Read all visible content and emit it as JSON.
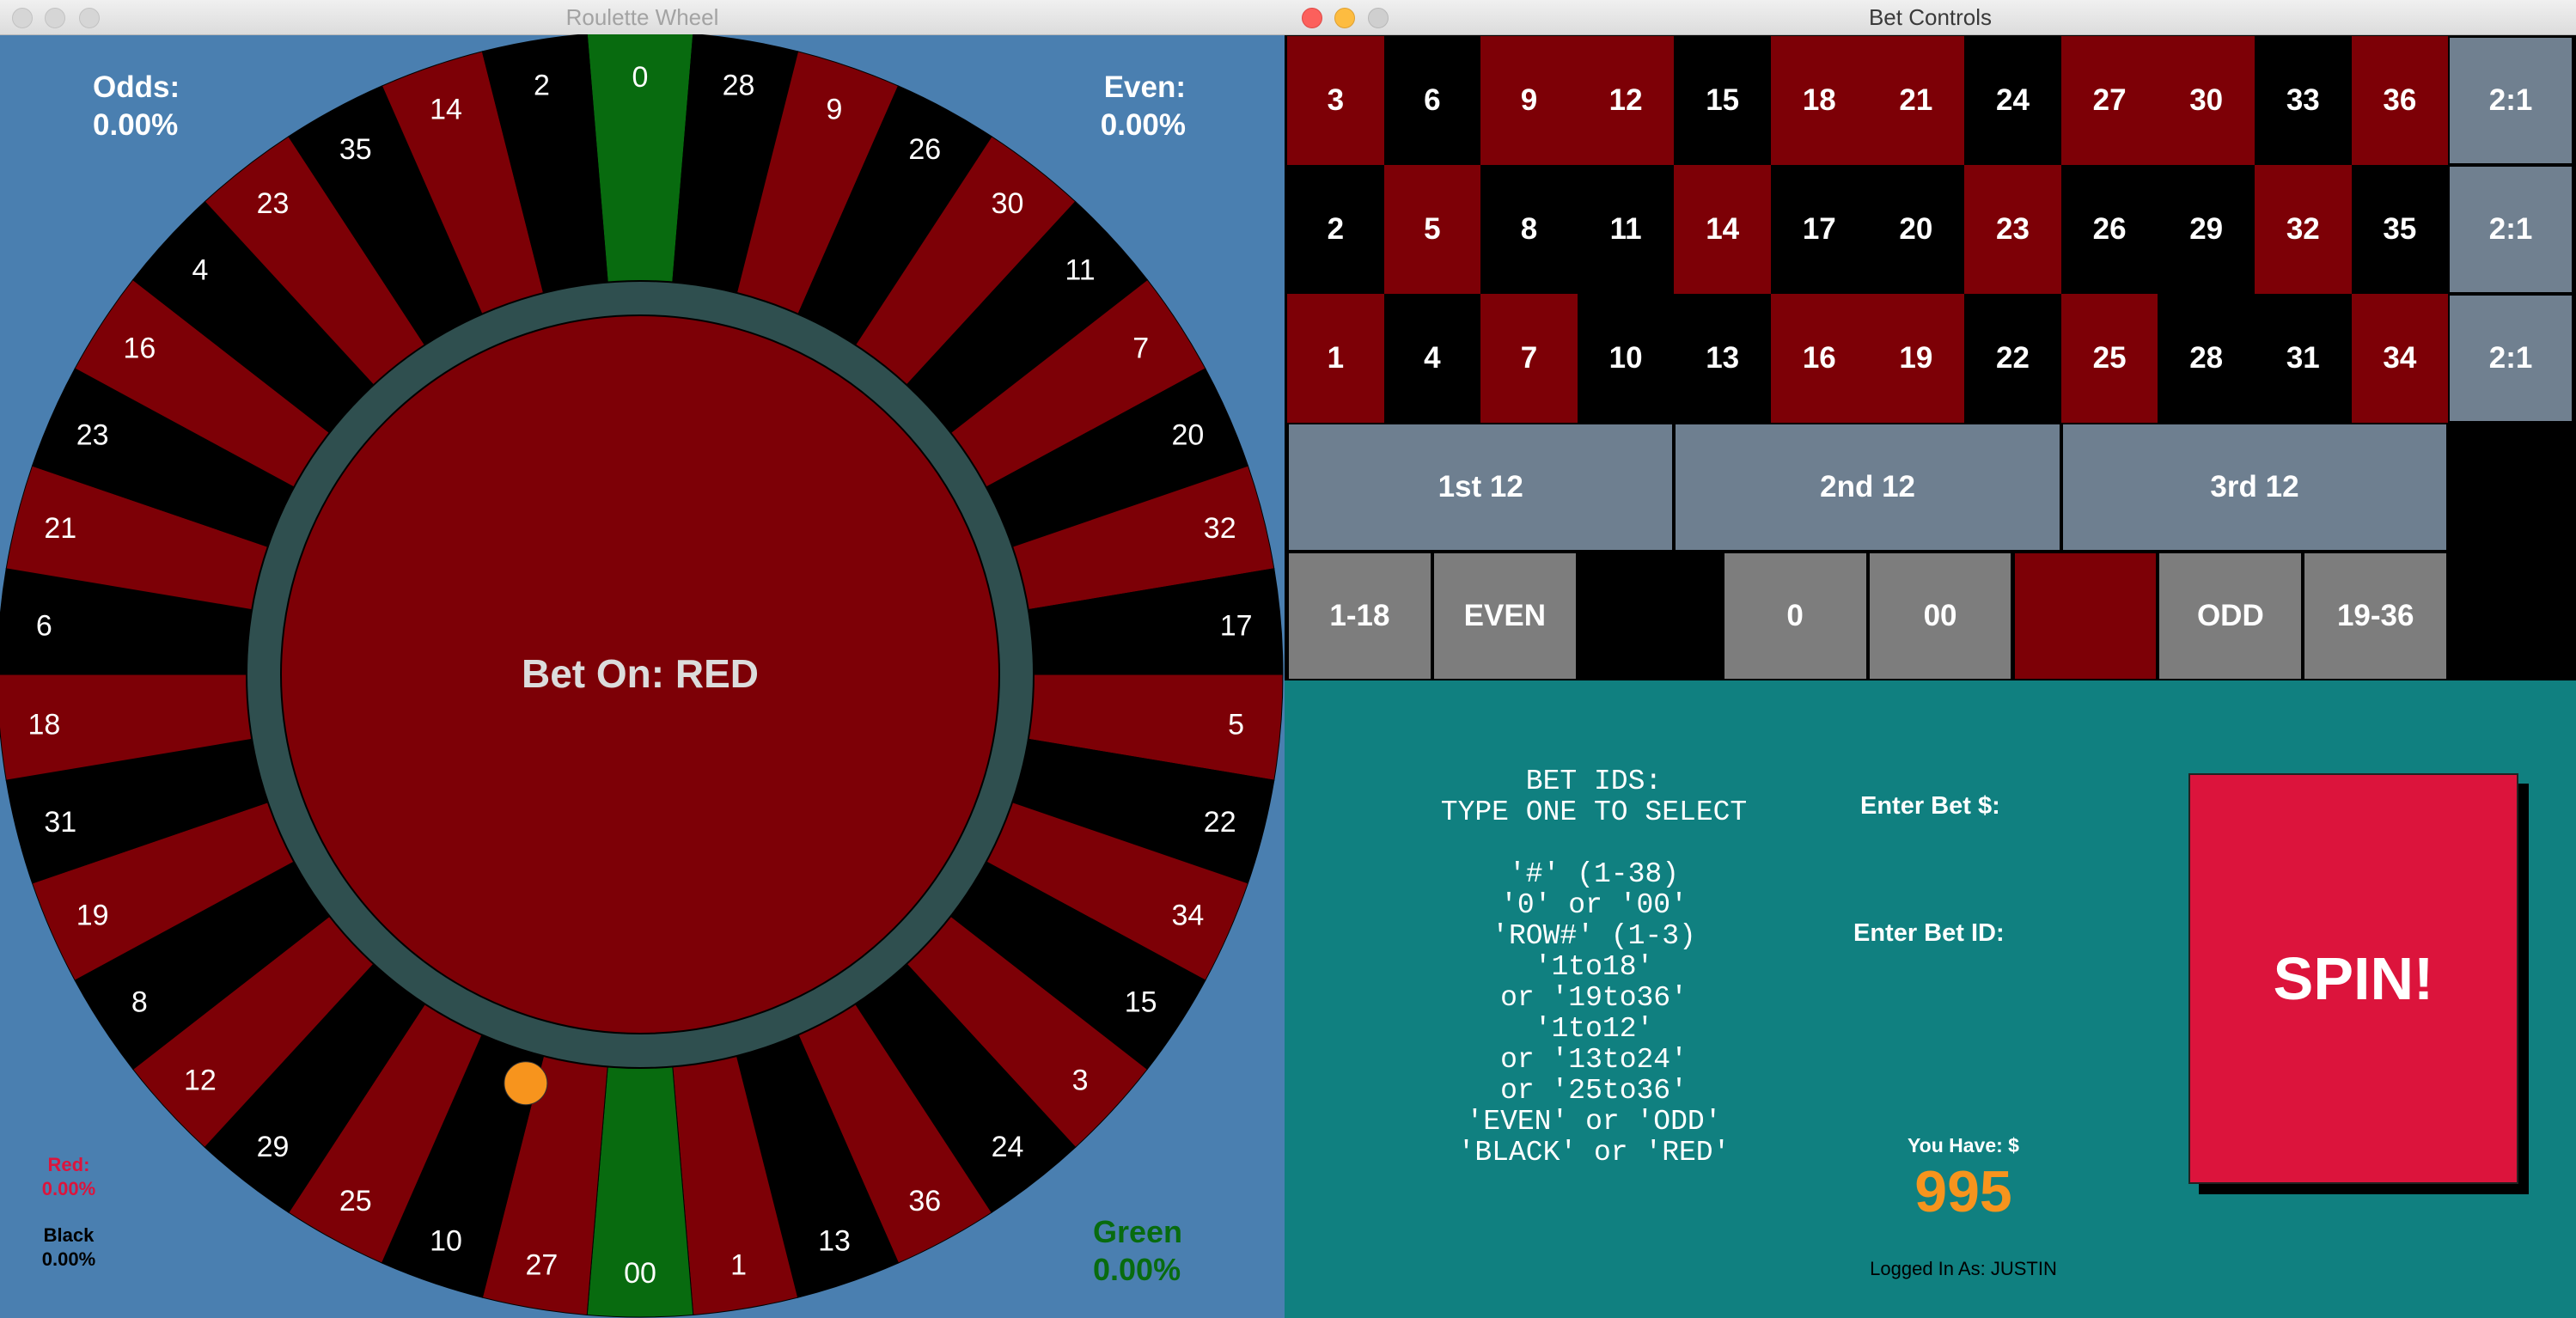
{
  "wheel_window": {
    "title": "Roulette Wheel",
    "odds_label": "Odds:",
    "odds_value": "0.00%",
    "even_label": "Even:",
    "even_value": "0.00%",
    "red_label": "Red:",
    "red_value": "0.00%",
    "black_label": "Black",
    "black_value": "0.00%",
    "green_label": "Green",
    "green_value": "0.00%",
    "center_text": "Bet On: RED",
    "pockets": [
      {
        "n": "0",
        "c": "green"
      },
      {
        "n": "28",
        "c": "black"
      },
      {
        "n": "9",
        "c": "red"
      },
      {
        "n": "26",
        "c": "black"
      },
      {
        "n": "30",
        "c": "red"
      },
      {
        "n": "11",
        "c": "black"
      },
      {
        "n": "7",
        "c": "red"
      },
      {
        "n": "20",
        "c": "black"
      },
      {
        "n": "32",
        "c": "red"
      },
      {
        "n": "17",
        "c": "black"
      },
      {
        "n": "5",
        "c": "red"
      },
      {
        "n": "22",
        "c": "black"
      },
      {
        "n": "34",
        "c": "red"
      },
      {
        "n": "15",
        "c": "black"
      },
      {
        "n": "3",
        "c": "red"
      },
      {
        "n": "24",
        "c": "black"
      },
      {
        "n": "36",
        "c": "red"
      },
      {
        "n": "13",
        "c": "black"
      },
      {
        "n": "1",
        "c": "red"
      },
      {
        "n": "00",
        "c": "green"
      },
      {
        "n": "27",
        "c": "red"
      },
      {
        "n": "10",
        "c": "black"
      },
      {
        "n": "25",
        "c": "red"
      },
      {
        "n": "29",
        "c": "black"
      },
      {
        "n": "12",
        "c": "red"
      },
      {
        "n": "8",
        "c": "black"
      },
      {
        "n": "19",
        "c": "red"
      },
      {
        "n": "31",
        "c": "black"
      },
      {
        "n": "18",
        "c": "red"
      },
      {
        "n": "6",
        "c": "black"
      },
      {
        "n": "21",
        "c": "red"
      },
      {
        "n": "23",
        "c": "black"
      },
      {
        "n": "16",
        "c": "red"
      },
      {
        "n": "4",
        "c": "black"
      },
      {
        "n": "23",
        "c": "red"
      },
      {
        "n": "35",
        "c": "black"
      },
      {
        "n": "14",
        "c": "red"
      },
      {
        "n": "2",
        "c": "black"
      }
    ],
    "ball_pocket": "10",
    "colors": {
      "red": "#7d0006",
      "black": "#000000",
      "green": "#086b0f",
      "ring": "#2f4f4f",
      "ball": "#f7941d",
      "background": "#4a7fb0",
      "red_text": "#dc143c",
      "green_text": "#086b0f"
    }
  },
  "controls_window": {
    "title": "Bet Controls",
    "number_rows": [
      [
        {
          "n": "3",
          "c": "red"
        },
        {
          "n": "6",
          "c": "black"
        },
        {
          "n": "9",
          "c": "red"
        },
        {
          "n": "12",
          "c": "red"
        },
        {
          "n": "15",
          "c": "black"
        },
        {
          "n": "18",
          "c": "red"
        },
        {
          "n": "21",
          "c": "red"
        },
        {
          "n": "24",
          "c": "black"
        },
        {
          "n": "27",
          "c": "red"
        },
        {
          "n": "30",
          "c": "red"
        },
        {
          "n": "33",
          "c": "black"
        },
        {
          "n": "36",
          "c": "red"
        }
      ],
      [
        {
          "n": "2",
          "c": "black"
        },
        {
          "n": "5",
          "c": "red"
        },
        {
          "n": "8",
          "c": "black"
        },
        {
          "n": "11",
          "c": "black"
        },
        {
          "n": "14",
          "c": "red"
        },
        {
          "n": "17",
          "c": "black"
        },
        {
          "n": "20",
          "c": "black"
        },
        {
          "n": "23",
          "c": "red"
        },
        {
          "n": "26",
          "c": "black"
        },
        {
          "n": "29",
          "c": "black"
        },
        {
          "n": "32",
          "c": "red"
        },
        {
          "n": "35",
          "c": "black"
        }
      ],
      [
        {
          "n": "1",
          "c": "red"
        },
        {
          "n": "4",
          "c": "black"
        },
        {
          "n": "7",
          "c": "red"
        },
        {
          "n": "10",
          "c": "black"
        },
        {
          "n": "13",
          "c": "black"
        },
        {
          "n": "16",
          "c": "red"
        },
        {
          "n": "19",
          "c": "red"
        },
        {
          "n": "22",
          "c": "black"
        },
        {
          "n": "25",
          "c": "red"
        },
        {
          "n": "28",
          "c": "black"
        },
        {
          "n": "31",
          "c": "black"
        },
        {
          "n": "34",
          "c": "red"
        }
      ]
    ],
    "row_bets": [
      "2:1",
      "2:1",
      "2:1"
    ],
    "dozens": [
      "1st 12",
      "2nd 12",
      "3rd 12"
    ],
    "outside_bets": [
      {
        "label": "1-18",
        "style": "outside"
      },
      {
        "label": "EVEN",
        "style": "outside"
      },
      {
        "label": "",
        "style": "outblack"
      },
      {
        "label": "0",
        "style": "outside"
      },
      {
        "label": "00",
        "style": "outside"
      },
      {
        "label": "",
        "style": "outred"
      },
      {
        "label": "ODD",
        "style": "outside"
      },
      {
        "label": "19-36",
        "style": "outside"
      }
    ],
    "bet_ids_text": [
      "BET IDS:",
      "TYPE ONE TO SELECT",
      "",
      "'#' (1-38)",
      "'0' or '00'",
      "'ROW#' (1-3)",
      "'1to18'",
      "or '19to36'",
      "'1to12'",
      "or '13to24'",
      "or '25to36'",
      "'EVEN' or 'ODD'",
      "'BLACK' or 'RED'"
    ],
    "enter_bet_amount_label": "Enter Bet $:",
    "enter_bet_id_label": "Enter Bet ID:",
    "you_have_label": "You Have: $",
    "balance": "995",
    "logged_in": "Logged In As: JUSTIN",
    "spin_label": "SPIN!",
    "colors": {
      "panel": "#108080",
      "spin": "#dc143c",
      "balance": "#f7941d"
    }
  }
}
